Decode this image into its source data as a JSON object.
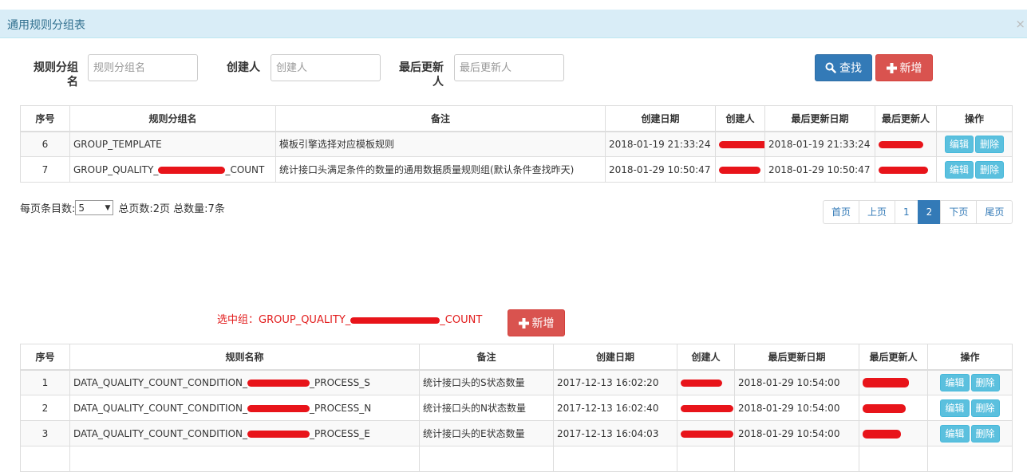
{
  "panel": {
    "title": "通用规则分组表",
    "close": "×"
  },
  "search": {
    "group_label": "规则分组名",
    "group_placeholder": "规则分组名",
    "creator_label": "创建人",
    "creator_placeholder": "创建人",
    "updater_label": "最后更新人",
    "updater_placeholder": "最后更新人",
    "search_button": "查找",
    "add_button": "新增"
  },
  "group_table": {
    "headers": [
      "序号",
      "规则分组名",
      "备注",
      "创建日期",
      "创建人",
      "最后更新日期",
      "最后更新人",
      "操作"
    ],
    "rows": [
      {
        "index": "6",
        "name": "GROUP_TEMPLATE",
        "name_suffix": "",
        "remark": "模板引擎选择对应模板规则",
        "created": "2018-01-19 21:33:24",
        "updated": "2018-01-19 21:33:24"
      },
      {
        "index": "7",
        "name": "GROUP_QUALITY_",
        "name_suffix": "_COUNT",
        "remark": "统计接口头满足条件的数量的通用数据质量规则组(默认条件查找昨天)",
        "created": "2018-01-29 10:50:47",
        "updated": "2018-01-29 10:50:47"
      }
    ],
    "edit": "编辑",
    "delete": "删除"
  },
  "pagination": {
    "per_page_label": "每页条目数:",
    "per_page_value": "5",
    "summary": "总页数:2页 总数量:7条",
    "first": "首页",
    "prev": "上页",
    "p1": "1",
    "p2": "2",
    "next": "下页",
    "last": "尾页"
  },
  "selected": {
    "label": "选中组：GROUP_QUALITY_",
    "suffix": "_COUNT",
    "add_button": "新增"
  },
  "rule_table": {
    "headers": [
      "序号",
      "规则名称",
      "备注",
      "创建日期",
      "创建人",
      "最后更新日期",
      "最后更新人",
      "操作"
    ],
    "rows": [
      {
        "index": "1",
        "prefix": "DATA_QUALITY_COUNT_CONDITION_",
        "suffix": "_PROCESS_S",
        "remark": "统计接口头的S状态数量",
        "created": "2017-12-13 16:02:20",
        "updated": "2018-01-29 10:54:00"
      },
      {
        "index": "2",
        "prefix": "DATA_QUALITY_COUNT_CONDITION_",
        "suffix": "_PROCESS_N",
        "remark": "统计接口头的N状态数量",
        "created": "2017-12-13 16:02:40",
        "updated": "2018-01-29 10:54:00"
      },
      {
        "index": "3",
        "prefix": "DATA_QUALITY_COUNT_CONDITION_",
        "suffix": "_PROCESS_E",
        "remark": "统计接口头的E状态数量",
        "created": "2017-12-13 16:04:03",
        "updated": "2018-01-29 10:54:00"
      }
    ],
    "edit": "编辑",
    "delete": "删除"
  },
  "colors": {
    "primary": "#337ab7",
    "danger": "#d9534f",
    "info": "#5bc0de",
    "panel": "#d9edf7",
    "redact": "#e8141a"
  },
  "icons": {
    "search": "search-icon",
    "plus": "plus-icon"
  }
}
